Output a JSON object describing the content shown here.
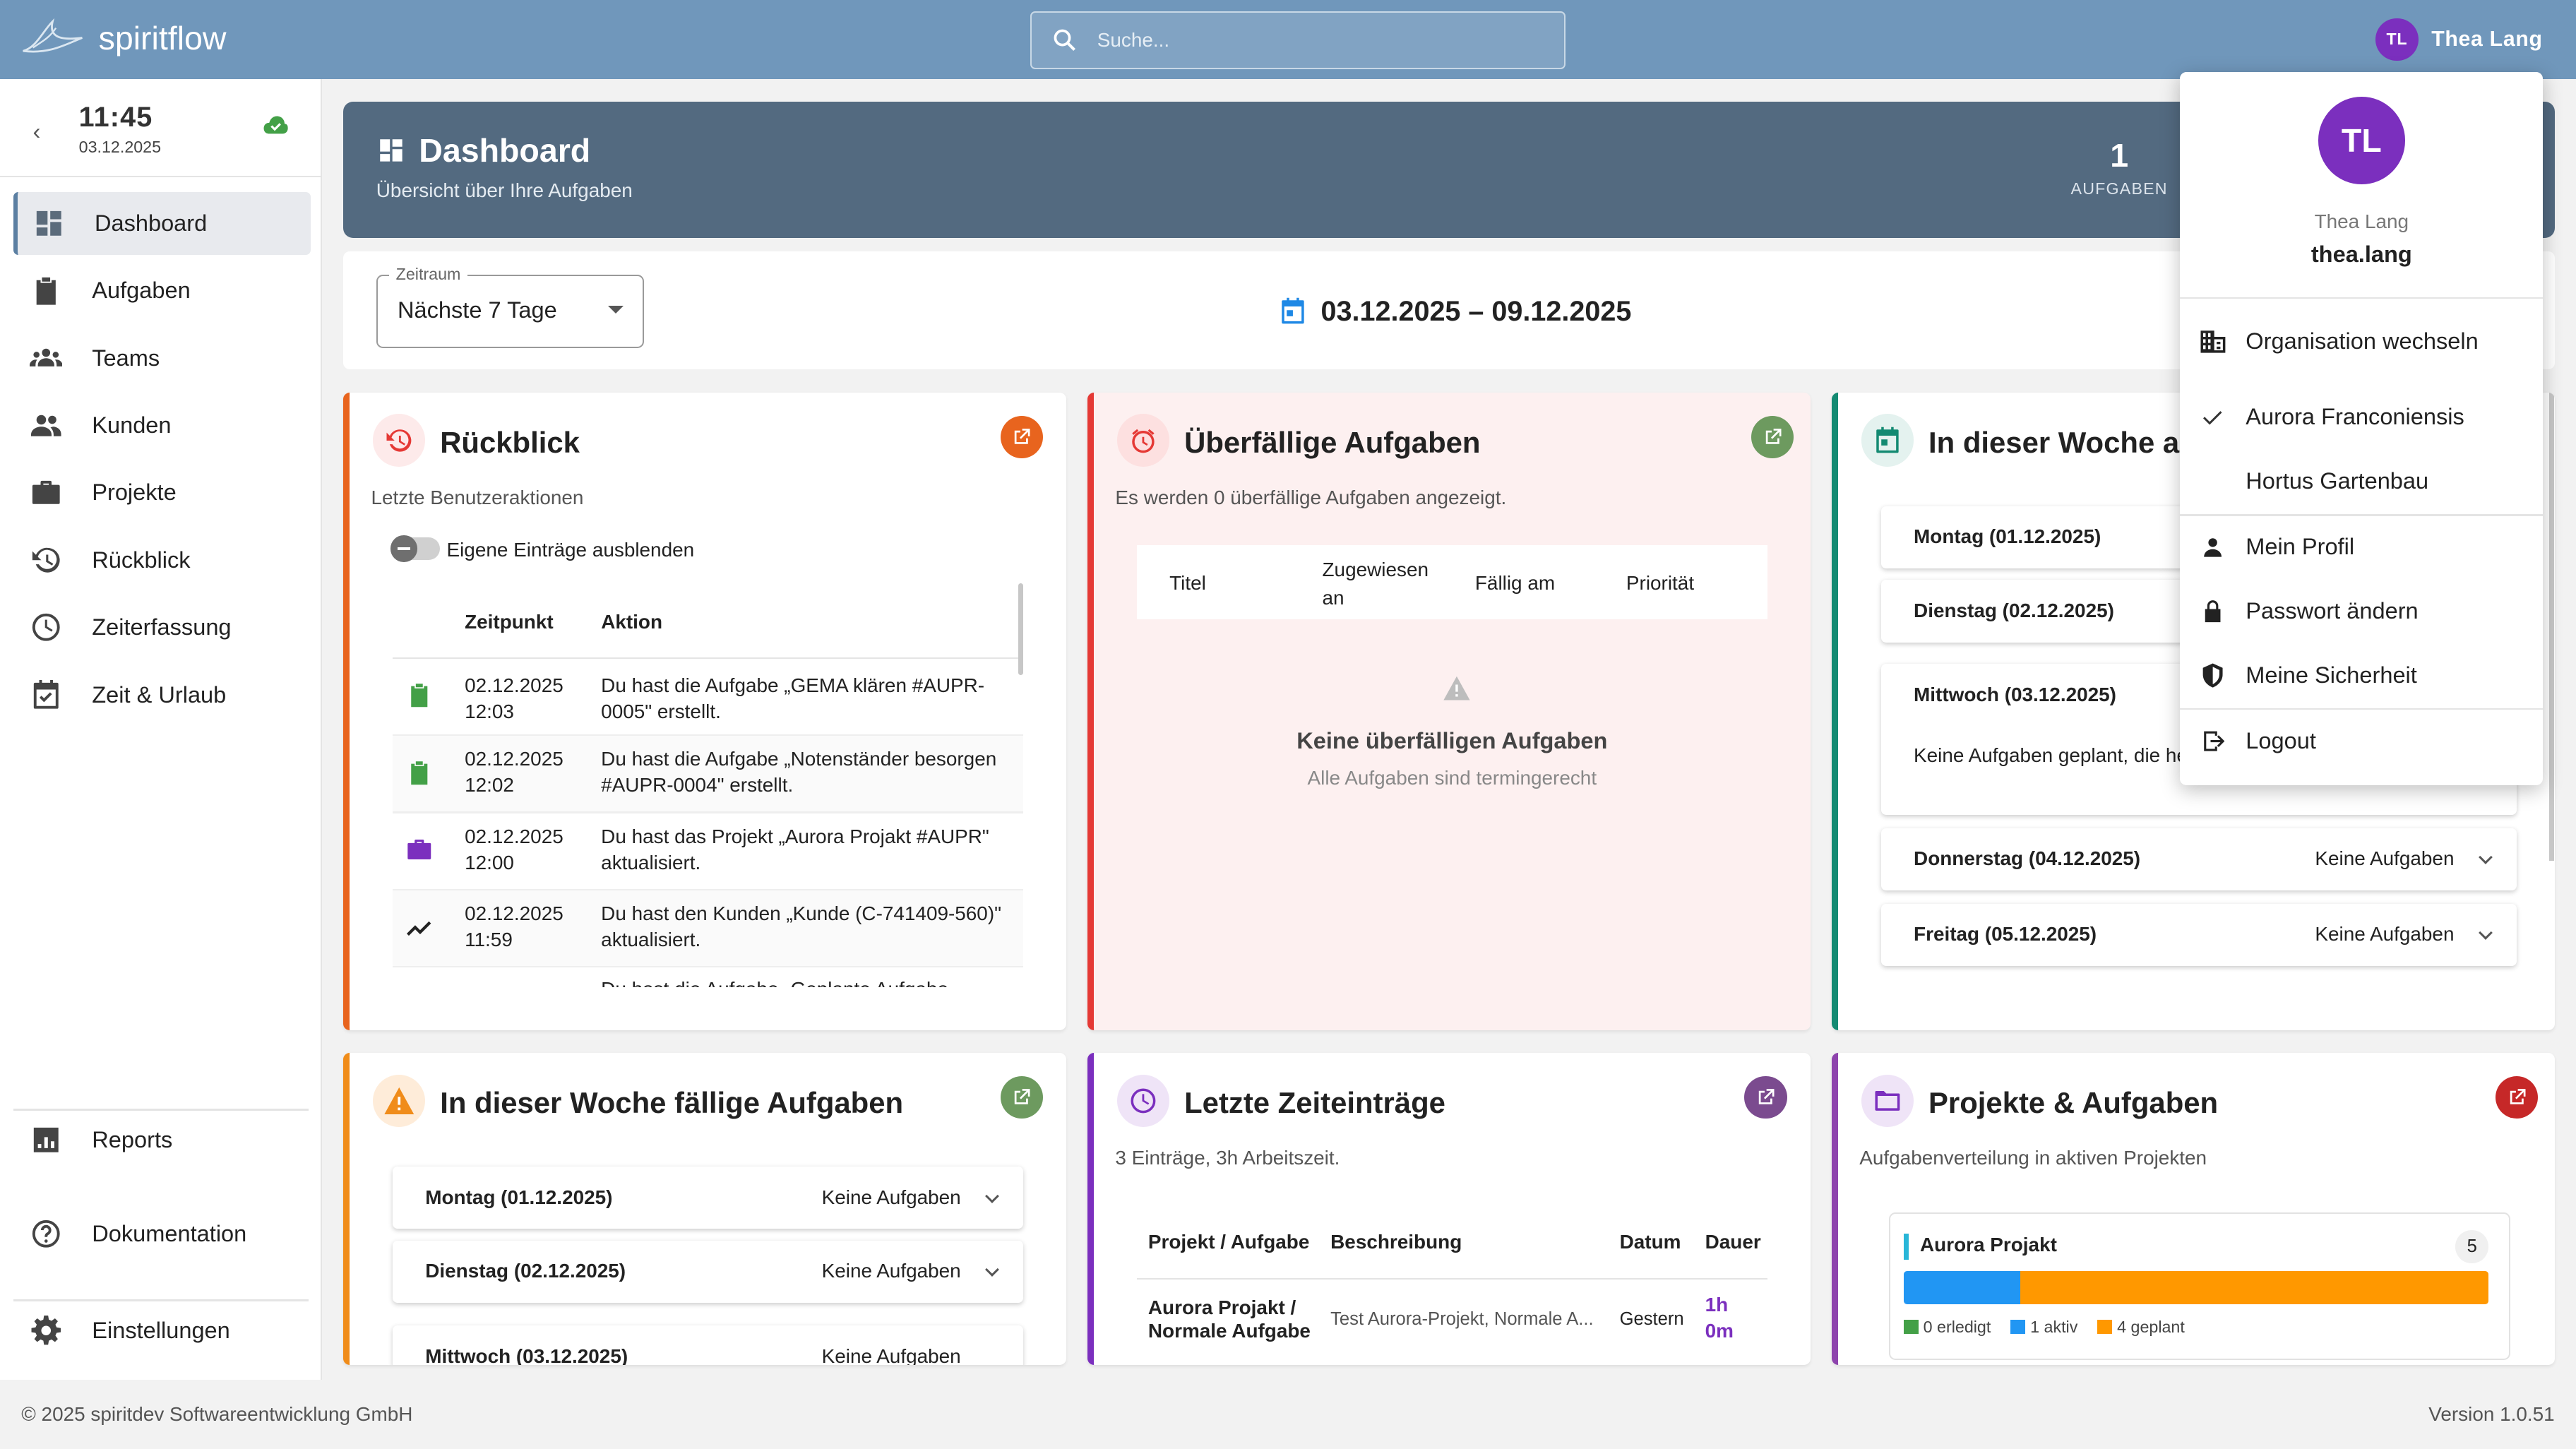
{
  "app": {
    "name": "spiritflow"
  },
  "search": {
    "placeholder": "Suche..."
  },
  "user": {
    "initials": "TL",
    "name": "Thea Lang",
    "username": "thea.lang"
  },
  "clock": {
    "time": "11:45",
    "date": "03.12.2025"
  },
  "sidebar": {
    "items": [
      {
        "label": "Dashboard",
        "icon": "dashboard-icon",
        "active": true
      },
      {
        "label": "Aufgaben",
        "icon": "clipboard-icon"
      },
      {
        "label": "Teams",
        "icon": "teams-icon"
      },
      {
        "label": "Kunden",
        "icon": "people-icon"
      },
      {
        "label": "Projekte",
        "icon": "briefcase-icon"
      },
      {
        "label": "Rückblick",
        "icon": "history-icon"
      },
      {
        "label": "Zeiterfassung",
        "icon": "clock-icon"
      },
      {
        "label": "Zeit & Urlaub",
        "icon": "calendar-check-icon"
      }
    ],
    "bottom": [
      {
        "label": "Reports",
        "icon": "bar-chart-icon"
      },
      {
        "label": "Dokumentation",
        "icon": "help-icon"
      },
      {
        "label": "Einstellungen",
        "icon": "gear-icon"
      }
    ]
  },
  "hero": {
    "title": "Dashboard",
    "subtitle": "Übersicht über Ihre Aufgaben",
    "count": "1",
    "count_label": "AUFGABEN"
  },
  "filter": {
    "label": "Zeitraum",
    "value": "Nächste 7 Tage",
    "range": "03.12.2025 – 09.12.2025"
  },
  "review": {
    "title": "Rückblick",
    "subtitle": "Letzte Benutzeraktionen",
    "toggle_label": "Eigene Einträge ausblenden",
    "col_time": "Zeitpunkt",
    "col_action": "Aktion",
    "rows": [
      {
        "date": "02.12.2025",
        "time": "12:03",
        "l1": "Du hast die Aufgabe „GEMA klären #AUPR-",
        "l2": "0005\" erstellt.",
        "icon": "clipboard-icon",
        "color": "#43a047"
      },
      {
        "date": "02.12.2025",
        "time": "12:02",
        "l1": "Du hast die Aufgabe „Notenständer besorgen",
        "l2": "#AUPR-0004\" erstellt.",
        "icon": "clipboard-icon",
        "color": "#43a047"
      },
      {
        "date": "02.12.2025",
        "time": "12:00",
        "l1": "Du hast das Projekt „Aurora Projakt #AUPR\"",
        "l2": "aktualisiert.",
        "icon": "briefcase-icon",
        "color": "#7b2fbe"
      },
      {
        "date": "02.12.2025",
        "time": "11:59",
        "l1": "Du hast den Kunden „Kunde (C-741409-560)\"",
        "l2": "aktualisiert.",
        "icon": "trend-icon",
        "color": "#222"
      }
    ],
    "cut_row": "Du hast die Aufgabe „Geplante Aufgabe"
  },
  "overdue": {
    "title": "Überfällige Aufgaben",
    "subtitle": "Es werden 0 überfällige Aufgaben angezeigt.",
    "cols": [
      "Titel",
      "Zugewiesen",
      "an",
      "Fällig am",
      "Priorität"
    ],
    "empty_title": "Keine überfälligen Aufgaben",
    "empty_sub": "Alle Aufgaben sind termingerecht"
  },
  "week_start": {
    "title": "In dieser Woche ans",
    "days": [
      {
        "label": "Montag (01.12.2025)"
      },
      {
        "label": "Dienstag (02.12.2025)"
      },
      {
        "label": "Mittwoch (03.12.2025)",
        "body": "Keine Aufgaben geplant, die he"
      },
      {
        "label": "Donnerstag (04.12.2025)",
        "status": "Keine Aufgaben"
      },
      {
        "label": "Freitag (05.12.2025)",
        "status": "Keine Aufgaben"
      }
    ]
  },
  "week_due": {
    "title": "In dieser Woche fällige Aufgaben",
    "days": [
      {
        "label": "Montag (01.12.2025)",
        "status": "Keine Aufgaben"
      },
      {
        "label": "Dienstag (02.12.2025)",
        "status": "Keine Aufgaben"
      },
      {
        "label": "Mittwoch (03.12.2025)",
        "status": "Keine Aufgaben"
      }
    ]
  },
  "time_entries": {
    "title": "Letzte Zeiteinträge",
    "subtitle": "3 Einträge, 3h Arbeitszeit.",
    "cols": [
      "Projekt / Aufgabe",
      "Beschreibung",
      "Datum",
      "Dauer"
    ],
    "row": {
      "p1": "Aurora Projakt /",
      "p2": "Normale Aufgabe",
      "desc": "Test Aurora-Projekt, Normale A...",
      "date": "Gestern",
      "d1": "1h",
      "d2": "0m"
    }
  },
  "projects": {
    "title": "Projekte & Aufgaben",
    "subtitle": "Aufgabenverteilung in aktiven Projekten",
    "items": [
      {
        "name": "Aurora Projakt",
        "count": "5",
        "done": 0,
        "active": 1,
        "planned": 4,
        "legend_done": "0 erledigt",
        "legend_active": "1 aktiv",
        "legend_planned": "4 geplant"
      }
    ]
  },
  "menu": {
    "switch_org": "Organisation wechseln",
    "orgs": [
      {
        "label": "Aurora Franconiensis",
        "selected": true
      },
      {
        "label": "Hortus Gartenbau",
        "selected": false
      }
    ],
    "profile": "Mein Profil",
    "password": "Passwort ändern",
    "security": "Meine Sicherheit",
    "logout": "Logout"
  },
  "footer": {
    "copyright": "© 2025 spiritdev Softwareentwicklung GmbH",
    "version": "Version 1.0.51"
  },
  "colors": {
    "topbar": "#7097bb",
    "hero": "#536a80",
    "accent_purple": "#7b2fbe",
    "done": "#43a047",
    "active": "#2196f3",
    "planned": "#ff9800"
  }
}
